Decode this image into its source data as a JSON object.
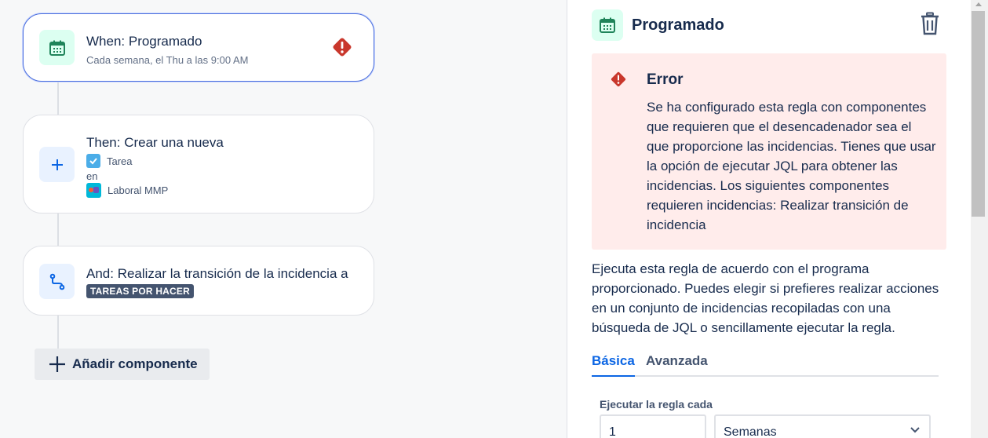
{
  "colors": {
    "accent": "#0c66e4",
    "error_bg": "#ffeceb",
    "error_icon": "#c9372c",
    "trigger_green": "#1f845a",
    "lozenge_bg": "#44546f"
  },
  "canvas": {
    "trigger": {
      "title": "When: Programado",
      "subtitle": "Cada semana, el Thu a las 9:00 AM",
      "icon": "calendar-icon",
      "status_icon": "error-icon"
    },
    "action": {
      "title": "Then: Crear una nueva",
      "issue_type": "Tarea",
      "connector_word": "en",
      "project": "Laboral MMP",
      "icon": "plus-icon"
    },
    "transition": {
      "title": "And: Realizar la transición de la incidencia a",
      "status_lozenge": "TAREAS POR HACER",
      "icon": "transition-icon"
    },
    "add_component_label": "Añadir componente"
  },
  "panel": {
    "title": "Programado",
    "error": {
      "title": "Error",
      "message": "Se ha configurado esta regla con componentes que requieren que el desencadenador sea el que proporcione las incidencias. Tienes que usar la opción de ejecutar JQL para obtener las incidencias. Los siguientes componentes requieren incidencias: Realizar transición de incidencia"
    },
    "description": "Ejecuta esta regla de acuerdo con el programa proporcionado. Puedes elegir si prefieres realizar acciones en un conjunto de incidencias recopiladas con una búsqueda de JQL o sencillamente ejecutar la regla.",
    "tabs": [
      "Básica",
      "Avanzada"
    ],
    "active_tab": "Básica",
    "schedule": {
      "label": "Ejecutar la regla cada",
      "interval_value": "1",
      "unit_value": "Semanas"
    }
  }
}
